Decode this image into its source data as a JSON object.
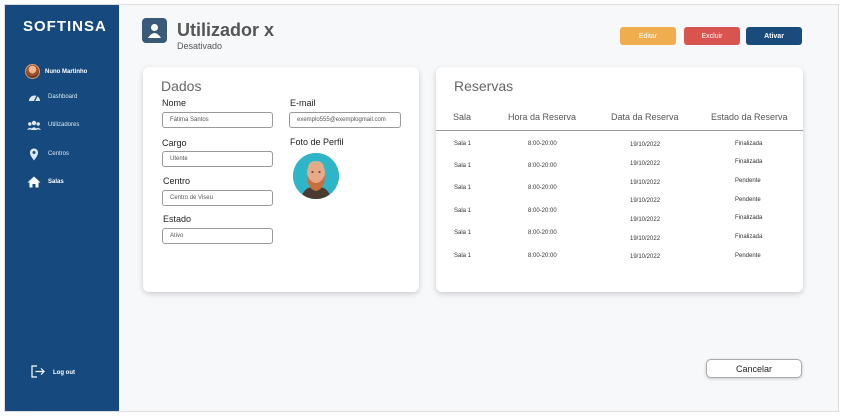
{
  "brand": "SOFTINSA",
  "user": {
    "name": "Nuno Martinho"
  },
  "sidebar": {
    "items": [
      {
        "label": "Dashboard",
        "icon": "speedometer-icon"
      },
      {
        "label": "Utilizadores",
        "icon": "users-icon"
      },
      {
        "label": "Centros",
        "icon": "location-pin-icon"
      },
      {
        "label": "Salas",
        "icon": "home-icon"
      }
    ],
    "logout": "Log out"
  },
  "header": {
    "title": "Utilizador x",
    "subtitle": "Desativado",
    "buttons": {
      "edit": "Editar",
      "delete": "Excluir",
      "activate": "Ativar"
    }
  },
  "dados": {
    "title": "Dados",
    "nome_label": "Nome",
    "nome_value": "Fátima Santos",
    "email_label": "E-mail",
    "email_value": "exemplo555@exemplogmail.com",
    "cargo_label": "Cargo",
    "cargo_value": "Utente",
    "foto_label": "Foto de Perfil",
    "centro_label": "Centro",
    "centro_value": "Centro de Viseu",
    "estado_label": "Estado",
    "estado_value": "Ativo"
  },
  "reservas": {
    "title": "Reservas",
    "columns": [
      "Sala",
      "Hora da Reserva",
      "Data da Reserva",
      "Estado da Reserva"
    ],
    "salas": [
      "Sala 1",
      "Sala 1",
      "Sala 1",
      "Sala 1",
      "Sala 1",
      "Sala 1"
    ],
    "horas": [
      "8:00-20:00",
      "8:00-20:00",
      "8:00-20:00",
      "8:00-20:00",
      "8:00-20:00",
      "8:00-20:00"
    ],
    "datas": [
      "19/10/2022",
      "19/10/2022",
      "19/10/2022",
      "19/10/2022",
      "19/10/2022",
      "19/10/2022",
      "19/10/2022"
    ],
    "estados": [
      "Finalizada",
      "Finalizada",
      "Pendente",
      "Pendente",
      "Finalizada",
      "Finalizada",
      "Pendente"
    ]
  },
  "cancel_label": "Cancelar",
  "colors": {
    "sidebar": "#164a7f",
    "edit": "#f0ad4e",
    "delete": "#d9534f",
    "activate": "#1b4a7c"
  }
}
